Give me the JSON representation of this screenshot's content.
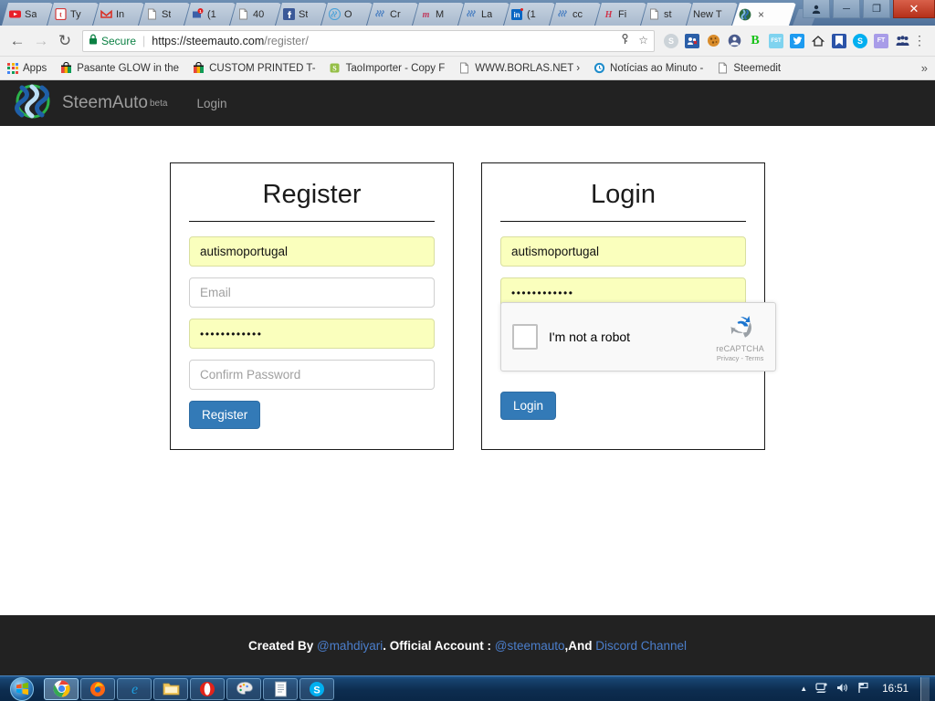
{
  "window": {
    "controls": {
      "user_icon": "user-icon",
      "minimize": "─",
      "maximize": "❐",
      "close": "✕"
    }
  },
  "tabs": [
    {
      "label": "Sa",
      "icon": "youtube-icon",
      "active": false
    },
    {
      "label": "Ty",
      "icon": "tumblr-icon",
      "active": false
    },
    {
      "label": "In",
      "icon": "gmail-icon",
      "active": false
    },
    {
      "label": "St",
      "icon": "document-icon",
      "active": false
    },
    {
      "label": "(1",
      "icon": "mail-badge-icon",
      "active": false
    },
    {
      "label": "40",
      "icon": "document-icon",
      "active": false
    },
    {
      "label": "St",
      "icon": "facebook-icon",
      "active": false
    },
    {
      "label": "O",
      "icon": "steem-icon",
      "active": false
    },
    {
      "label": "Cr",
      "icon": "steem-icon",
      "active": false
    },
    {
      "label": "M",
      "icon": "medium-icon",
      "active": false
    },
    {
      "label": "La",
      "icon": "steem-icon",
      "active": false
    },
    {
      "label": "(1",
      "icon": "linkedin-icon",
      "active": false
    },
    {
      "label": "cc",
      "icon": "steem-icon",
      "active": false
    },
    {
      "label": "Fi",
      "icon": "hitwebcounter-icon",
      "active": false
    },
    {
      "label": "st",
      "icon": "document-icon",
      "active": false
    },
    {
      "label": "New T",
      "icon": "none",
      "active": false
    },
    {
      "label": "",
      "icon": "steemauto-icon",
      "active": true,
      "close": "×"
    }
  ],
  "toolbar": {
    "back": "←",
    "forward": "→",
    "reload": "↻",
    "secure_label": "Secure",
    "url_main": "https://steemauto.com",
    "url_path": "/register/",
    "save_password_icon": "key-icon",
    "bookmark_star": "☆",
    "menu": "⋮",
    "extensions": [
      {
        "name": "skype-gray-ext",
        "glyph": "S",
        "color": "#b9c4cc"
      },
      {
        "name": "contacts-ext",
        "glyph": "\u0000",
        "color": "#2b5fa8"
      },
      {
        "name": "cookie-ext",
        "glyph": "\u0000",
        "color": "#d98c2b"
      },
      {
        "name": "avatar-ext",
        "glyph": "\u0000",
        "color": "#4a5b8c"
      },
      {
        "name": "bitcoin-b-ext",
        "glyph": "B",
        "color": "#ffffff"
      },
      {
        "name": "fst-ext",
        "glyph": "FST",
        "color": "#7fd3ef"
      },
      {
        "name": "twitter-ext",
        "glyph": "\u0000",
        "color": "#1d9bf0"
      },
      {
        "name": "home-ext",
        "glyph": "⌂",
        "color": "#ffffff"
      },
      {
        "name": "bookmark-ext",
        "glyph": "\u0000",
        "color": "#2b53a8"
      },
      {
        "name": "skype-ext",
        "glyph": "S",
        "color": "#00aff0"
      },
      {
        "name": "ft-ext",
        "glyph": "FT",
        "color": "#a89ce8"
      },
      {
        "name": "group-ext",
        "glyph": "\u0000",
        "color": "#2b3f7a"
      }
    ]
  },
  "bookmarks": {
    "apps_label": "Apps",
    "items": [
      {
        "label": "Pasante GLOW in the",
        "icon": "shopping-bag-icon"
      },
      {
        "label": "CUSTOM PRINTED T-",
        "icon": "shopping-bag-icon"
      },
      {
        "label": "TaoImporter - Copy F",
        "icon": "shopify-icon"
      },
      {
        "label": "WWW.BORLAS.NET ›",
        "icon": "document-icon"
      },
      {
        "label": "Notícias ao Minuto -",
        "icon": "clock-icon"
      },
      {
        "label": "Steemedit",
        "icon": "document-icon"
      }
    ],
    "overflow": "»"
  },
  "site": {
    "brand_name": "SteemAuto",
    "brand_beta": "beta",
    "nav_login": "Login",
    "logo_icon": "steem-logo-icon"
  },
  "register_card": {
    "title": "Register",
    "username_value": "autismoportugal",
    "email_placeholder": "Email",
    "password_value": "••••••••••••",
    "confirm_placeholder": "Confirm Password",
    "submit_label": "Register"
  },
  "login_card": {
    "title": "Login",
    "username_value": "autismoportugal",
    "password_value": "••••••••••••",
    "submit_label": "Login",
    "recaptcha": {
      "checkbox_label": "I'm not a robot",
      "brand": "reCAPTCHA",
      "terms": "Privacy - Terms",
      "logo_icon": "recaptcha-icon"
    }
  },
  "footer": {
    "created_by": "Created By ",
    "author": "@mahdiyari",
    "middle": ". Official Account : ",
    "account": "@steemauto",
    "and": ",And ",
    "discord": "Discord Channel"
  },
  "taskbar": {
    "start": "start-orb",
    "items": [
      {
        "name": "chrome-taskbar-icon",
        "active": true
      },
      {
        "name": "firefox-taskbar-icon",
        "active": false
      },
      {
        "name": "internet-explorer-taskbar-icon",
        "active": false
      },
      {
        "name": "windows-explorer-taskbar-icon",
        "active": false
      },
      {
        "name": "opera-taskbar-icon",
        "active": false
      },
      {
        "name": "paint-taskbar-icon",
        "active": false
      },
      {
        "name": "notepad-taskbar-icon",
        "active": false
      },
      {
        "name": "skype-taskbar-icon",
        "active": false
      }
    ],
    "tray": {
      "expand": "▲",
      "network_icon": "network-icon",
      "volume_icon": "volume-icon",
      "action_center_icon": "flag-icon",
      "clock": "16:51"
    }
  },
  "colors": {
    "accent_blue": "#337ab7",
    "header_dark": "#222222",
    "autofill_yellow": "#faffbd",
    "secure_green": "#0b8043",
    "link_blue": "#4b7ecb"
  }
}
